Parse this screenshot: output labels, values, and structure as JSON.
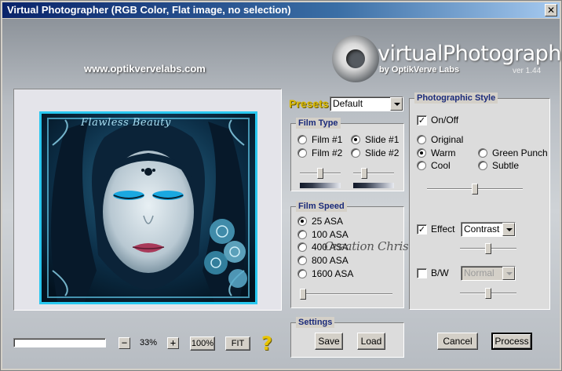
{
  "window": {
    "title": "Virtual Photographer (RGB Color, Flat image, no selection)"
  },
  "brand": {
    "title": "virtualPhotographer",
    "subtitle": "by OptikVerve Labs",
    "version": "ver 1.44",
    "website": "www.optikvervelabs.com"
  },
  "preview": {
    "photo_caption": "Flawless Beauty",
    "watermark": "Creation Christa"
  },
  "presets": {
    "label": "Presets",
    "value": "Default"
  },
  "film_type": {
    "title": "Film Type",
    "options": [
      {
        "label": "Film #1",
        "selected": false
      },
      {
        "label": "Film #2",
        "selected": false
      },
      {
        "label": "Slide #1",
        "selected": true
      },
      {
        "label": "Slide #2",
        "selected": false
      }
    ],
    "film_slider_level": 0.5,
    "slide_slider_level": 0.25
  },
  "film_speed": {
    "title": "Film Speed",
    "options": [
      {
        "label": "25 ASA",
        "selected": true
      },
      {
        "label": "100 ASA",
        "selected": false
      },
      {
        "label": "400 ASA",
        "selected": false
      },
      {
        "label": "800 ASA",
        "selected": false
      },
      {
        "label": "1600 ASA",
        "selected": false
      }
    ],
    "slider_level": 0.0
  },
  "photographic_style": {
    "title": "Photographic Style",
    "onoff": {
      "label": "On/Off",
      "checked": true
    },
    "options": [
      {
        "label": "Original",
        "selected": false
      },
      {
        "label": "Warm",
        "selected": true
      },
      {
        "label": "Cool",
        "selected": false
      },
      {
        "label": "Green Punch",
        "selected": false
      },
      {
        "label": "Subtle",
        "selected": false
      }
    ],
    "style_slider_level": 0.5,
    "effect": {
      "label": "Effect",
      "checked": true,
      "value": "Contrast",
      "slider_level": 0.5
    },
    "bw": {
      "label": "B/W",
      "checked": false,
      "value": "Normal",
      "slider_level": 0.5
    }
  },
  "settings": {
    "title": "Settings",
    "save_label": "Save",
    "load_label": "Load"
  },
  "zoom": {
    "minus": "−",
    "plus": "+",
    "value": "33%",
    "full_label": "100%",
    "fit_label": "FIT",
    "help": "?"
  },
  "actions": {
    "cancel_label": "Cancel",
    "process_label": "Process"
  },
  "colors": {
    "accent_yellow": "#d8b800",
    "panel_title": "#1a2a7a",
    "photo_border": "#29c8f0"
  }
}
